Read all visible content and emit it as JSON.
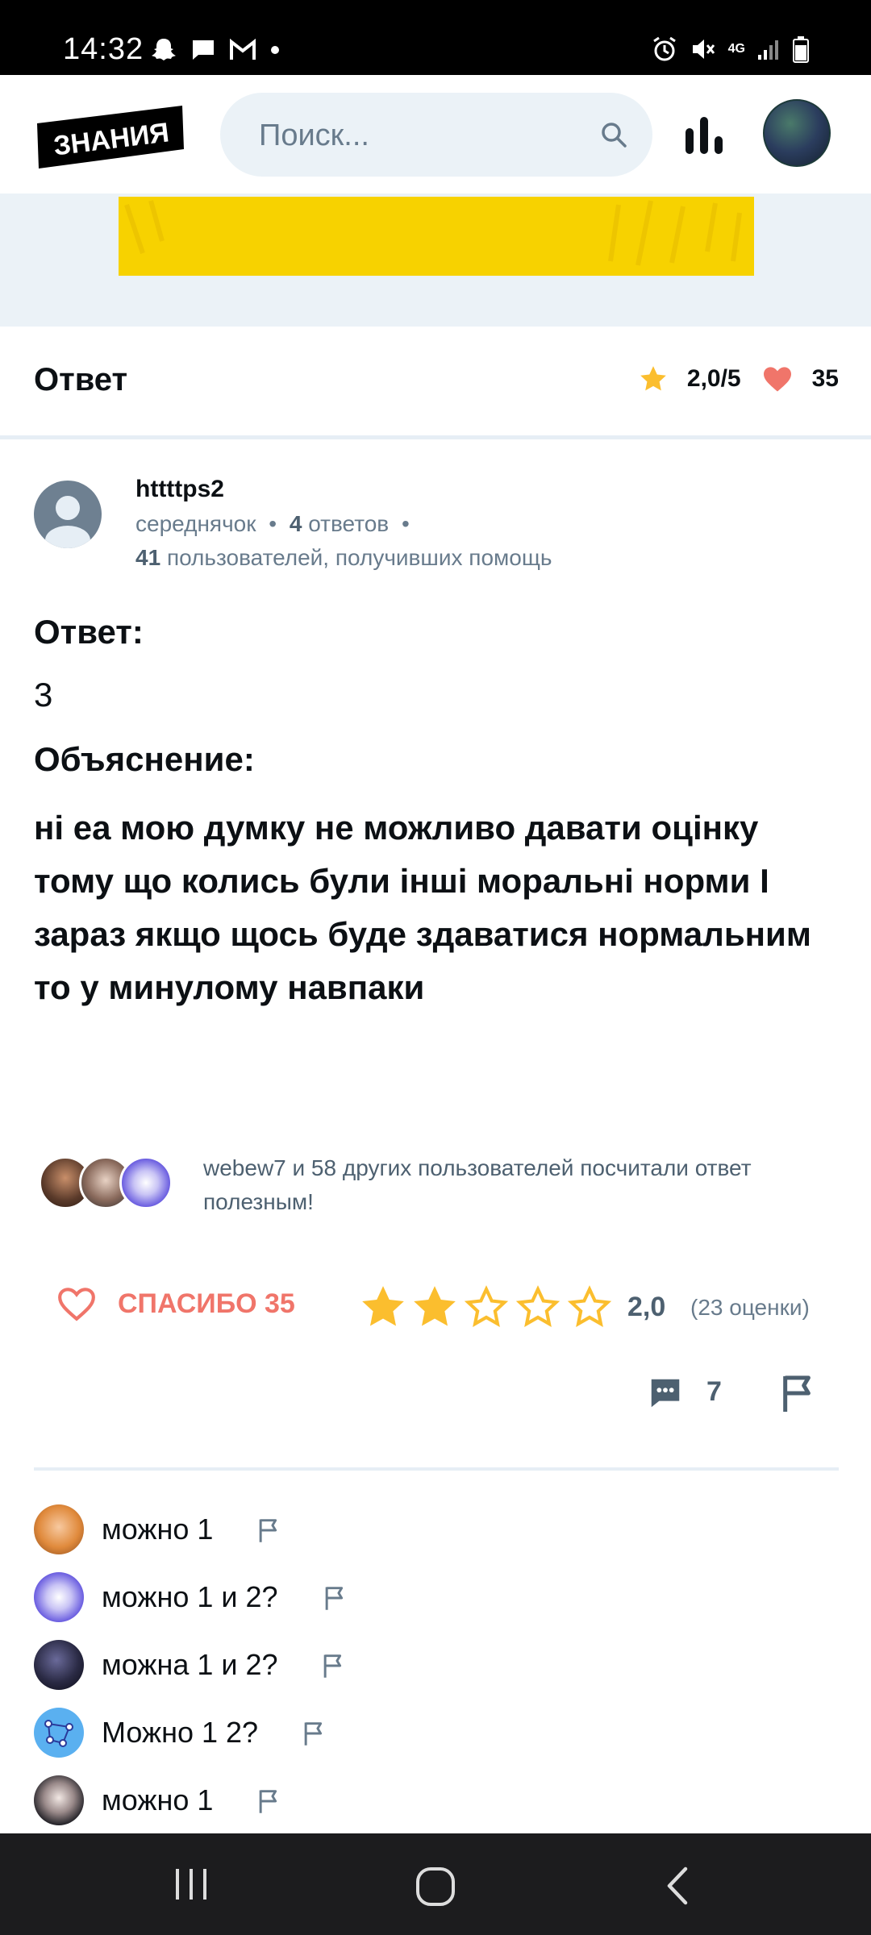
{
  "status_bar": {
    "time": "14:32",
    "network": "4G"
  },
  "header": {
    "logo_text": "ЗНАНИЯ",
    "search_placeholder": "Поиск..."
  },
  "answer_bar": {
    "title": "Ответ",
    "rating": "2,0/5",
    "likes": "35"
  },
  "author": {
    "name": "httttps2",
    "rank": "середнячок",
    "answers_count": "4",
    "answers_label": "ответов",
    "helped_count": "41",
    "helped_label": "пользователей, получивших помощь"
  },
  "answer": {
    "answer_heading": "Ответ:",
    "answer_value": "3",
    "explanation_heading": "Объяснение:",
    "explanation_text": "ні еа мою думку не можливо давати оцінку тому що колись були інші моральні норми І зараз якщо щось буде здаватися нормальним то у минулому навпаки"
  },
  "helpful": {
    "text": "webew7 и 58 других пользователей посчитали ответ полезным!"
  },
  "actions": {
    "thanks_label": "СПАСИБО 35",
    "stars_filled": 2,
    "stars_total": 5,
    "rating_value": "2,0",
    "rating_count": "(23 оценки)"
  },
  "tools": {
    "comments_count": "7"
  },
  "comments": [
    {
      "text": "можно 1"
    },
    {
      "text": "можно 1 и 2?"
    },
    {
      "text": "можна 1 и 2?"
    },
    {
      "text": "Можно 1 2?"
    },
    {
      "text": "можно 1"
    }
  ],
  "colors": {
    "accent_red": "#f0756a",
    "star_yellow": "#fbbe2e",
    "banner_yellow": "#f7d200",
    "muted": "#687b8c"
  }
}
